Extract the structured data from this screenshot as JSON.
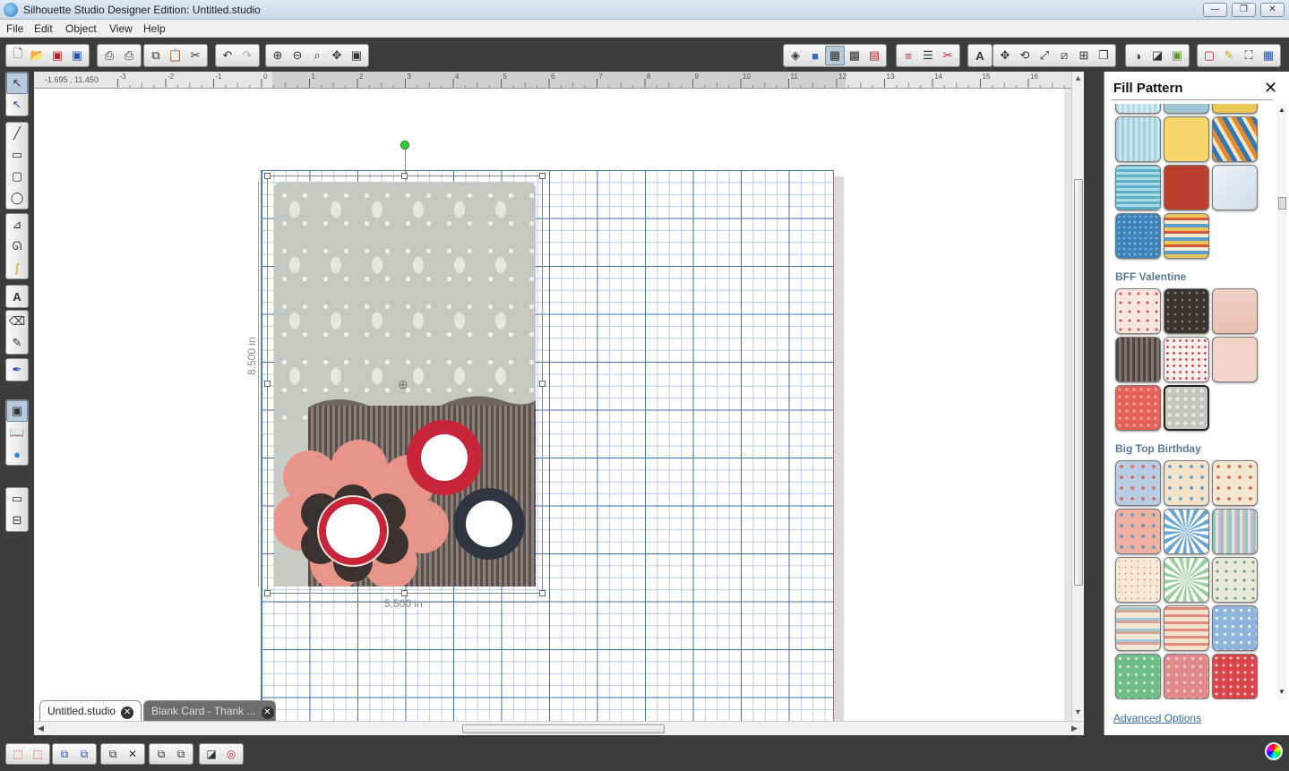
{
  "window": {
    "title": "Silhouette Studio Designer Edition: Untitled.studio",
    "controls": [
      "—",
      "❐",
      "✕"
    ]
  },
  "menu": [
    "File",
    "Edit",
    "Object",
    "View",
    "Help"
  ],
  "canvas": {
    "coordinates": "-1.695 , 11.450",
    "ruler_ticks": [
      "-3",
      "-2",
      "-1",
      "0",
      "1",
      "2",
      "3",
      "4",
      "5",
      "6",
      "7",
      "8",
      "9",
      "10",
      "11",
      "12",
      "13",
      "14",
      "15",
      "16"
    ],
    "width_label": "5.500 in",
    "height_label": "8.500 in"
  },
  "tabs": [
    {
      "label": "Untitled.studio",
      "active": true
    },
    {
      "label": "Blank Card - Thank ...",
      "active": false
    }
  ],
  "panel": {
    "title": "Fill Pattern",
    "sections": [
      {
        "title": "BFF Valentine"
      },
      {
        "title": "Big Top Birthday"
      }
    ],
    "advanced_link": "Advanced Options"
  },
  "colors": {
    "accent": "#3b6aa8",
    "grid_major": "#3f6fb0",
    "grid_minor": "#b8cbe6",
    "flower_red": "#c8253a",
    "flower_pink": "#e8948a",
    "flower_black": "#3a3230"
  }
}
